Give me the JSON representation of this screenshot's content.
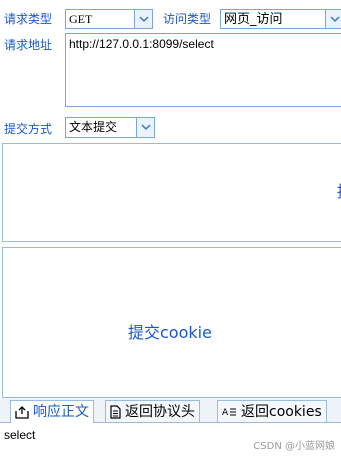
{
  "request": {
    "method_label": "请求类型",
    "method_value": "GET",
    "access_label": "访问类型",
    "access_value": "网页_访问",
    "url_label": "请求地址",
    "url_value": "http://127.0.0.1:8099/select",
    "submit_label": "提交方式",
    "submit_value": "文本提交"
  },
  "panels": {
    "top_text": "提",
    "cookie_text": "提交cookie"
  },
  "tabs": [
    {
      "label": "响应正文",
      "icon": "export-icon"
    },
    {
      "label": "返回协议头",
      "icon": "document-icon"
    },
    {
      "label": "返回cookies",
      "icon": "text-list-icon"
    }
  ],
  "response": {
    "body": "select",
    "watermark": "CSDN @小蓝网娘"
  },
  "colors": {
    "label": "#1a57c9",
    "border": "#7aa7d9",
    "tab_bg": "#eef3fa"
  }
}
